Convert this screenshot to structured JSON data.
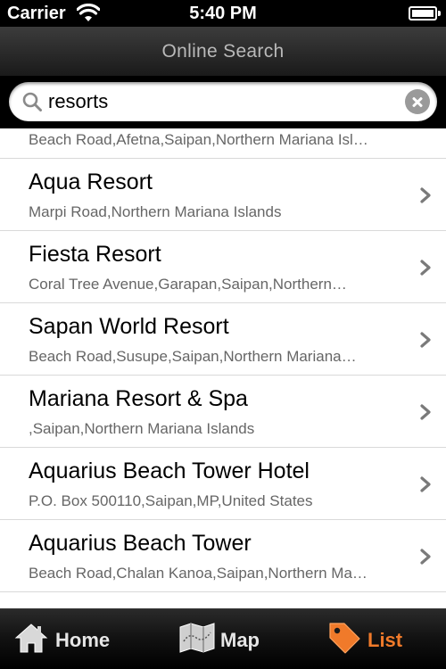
{
  "status_bar": {
    "carrier": "Carrier",
    "time": "5:40 PM",
    "wifi_icon": "wifi-icon",
    "battery_icon": "battery-icon"
  },
  "nav": {
    "title": "Online Search"
  },
  "search": {
    "value": "resorts",
    "icon": "search-icon",
    "clear_icon": "clear-icon"
  },
  "results": {
    "partial_item": {
      "address": "Beach Road,Afetna,Saipan,Northern Mariana Isl…"
    },
    "items": [
      {
        "name": "Aqua Resort",
        "address": "Marpi Road,Northern Mariana Islands"
      },
      {
        "name": "Fiesta Resort",
        "address": "Coral Tree Avenue,Garapan,Saipan,Northern…"
      },
      {
        "name": "Sapan World Resort",
        "address": "Beach Road,Susupe,Saipan,Northern Mariana…"
      },
      {
        "name": "Mariana Resort & Spa",
        "address": ",Saipan,Northern Mariana Islands"
      },
      {
        "name": "Aquarius Beach Tower Hotel",
        "address": "P.O. Box 500110,Saipan,MP,United States"
      },
      {
        "name": "Aquarius Beach Tower",
        "address": "Beach Road,Chalan Kanoa,Saipan,Northern Ma…"
      }
    ]
  },
  "tabs": [
    {
      "label": "Home",
      "icon": "home-icon",
      "selected": false
    },
    {
      "label": "Map",
      "icon": "map-icon",
      "selected": false
    },
    {
      "label": "List",
      "icon": "tag-icon",
      "selected": true
    }
  ],
  "colors": {
    "accent": "#f07a2a",
    "background": "#000000",
    "list_background": "#ffffff"
  }
}
